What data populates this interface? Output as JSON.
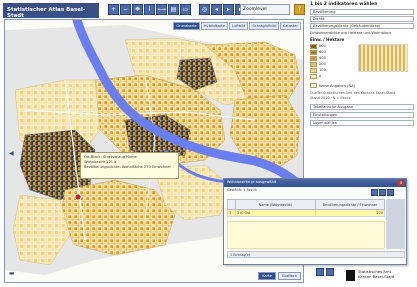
{
  "header": {
    "title": "Statistischer Atlas Basel-Stadt",
    "toolbar_icons": [
      "zoom-in-icon",
      "zoom-out-icon",
      "pan-icon",
      "info-icon",
      "measure-icon",
      "print-icon",
      "select-icon",
      "full-extent-icon",
      "back-icon",
      "forward-icon",
      "save-icon",
      "layer-icon",
      "refresh-icon"
    ],
    "scale_value": "Zoomlevel",
    "help_icon": "?"
  },
  "map": {
    "tabs": [
      {
        "label": "Grundkarte",
        "active": true
      },
      {
        "label": "Hybridkarte",
        "active": false
      },
      {
        "label": "Luftbild",
        "active": false
      },
      {
        "label": "Schräglufbild",
        "active": false
      },
      {
        "label": "Kataster",
        "active": false
      }
    ],
    "tooltip": {
      "line1": "Ort-Block: Strassenzug Name",
      "line2": "Wohnbezirk 121 a",
      "line3": "Bevölkerungsdichte: Wohnfläche 270 Einwohner"
    },
    "bottom_buttons": [
      {
        "label": "Karte",
        "active": true
      },
      {
        "label": "Grafiken",
        "active": false
      }
    ],
    "colors": {
      "river": "#6b7ef0",
      "background": "#fbfbf8",
      "low": "#f8e7b3",
      "mid": "#e9bd58",
      "high": "#d49a2a",
      "very_high": "#8a5a12",
      "dark": "#2b2b2b",
      "grey_area": "#d9d9d9"
    }
  },
  "panel": {
    "title": "1 bis 2 indikatoren wählen",
    "rows": [
      {
        "label": "Bevölkerung"
      },
      {
        "label": "Dichte"
      },
      {
        "label": "Bevölkerungsdichte (Gebäudeblöcke)"
      },
      {
        "label": "Einwohnerdichte pro Hektare und Wohnblock"
      }
    ],
    "legend_title": "Einw. / Hektare",
    "legend": [
      {
        "label": "800",
        "color": "#8a5a12"
      },
      {
        "label": "600",
        "color": "#b07a1e"
      },
      {
        "label": "400",
        "color": "#d49a2a"
      },
      {
        "label": "200",
        "color": "#e9bd58"
      },
      {
        "label": "100",
        "color": "#f2d489"
      },
      {
        "label": "0",
        "color": "#f8e7b3"
      }
    ],
    "na_label": "Keine Angaben (NA)",
    "source_line1": "Quelle: Statistisches Amt des Kantons Basel-Stadt",
    "source_line2": "Stand 2010 · N = Bezirk",
    "lower_rows": [
      {
        "label": "Tabellarische Ausgabe"
      },
      {
        "label": "Einstellungen"
      },
      {
        "label": "Layer wählen"
      }
    ]
  },
  "datawin": {
    "title": "Wohnbezirke je ausgewählt",
    "subtitle": "Gewählt: 1 Bezirk",
    "columns": [
      "",
      "Name (Wohnbezirk)",
      "Bevölkerungsdichte / Einwohner"
    ],
    "rows": [
      {
        "idx": "1",
        "name": "1 Kl Gut",
        "value": "270",
        "selected": true
      }
    ],
    "footer": "1 Eintrag(e)",
    "close_label": "x"
  },
  "logo": {
    "line1": "Statistisches Amt",
    "line2": "Kanton Basel-Stadt"
  }
}
